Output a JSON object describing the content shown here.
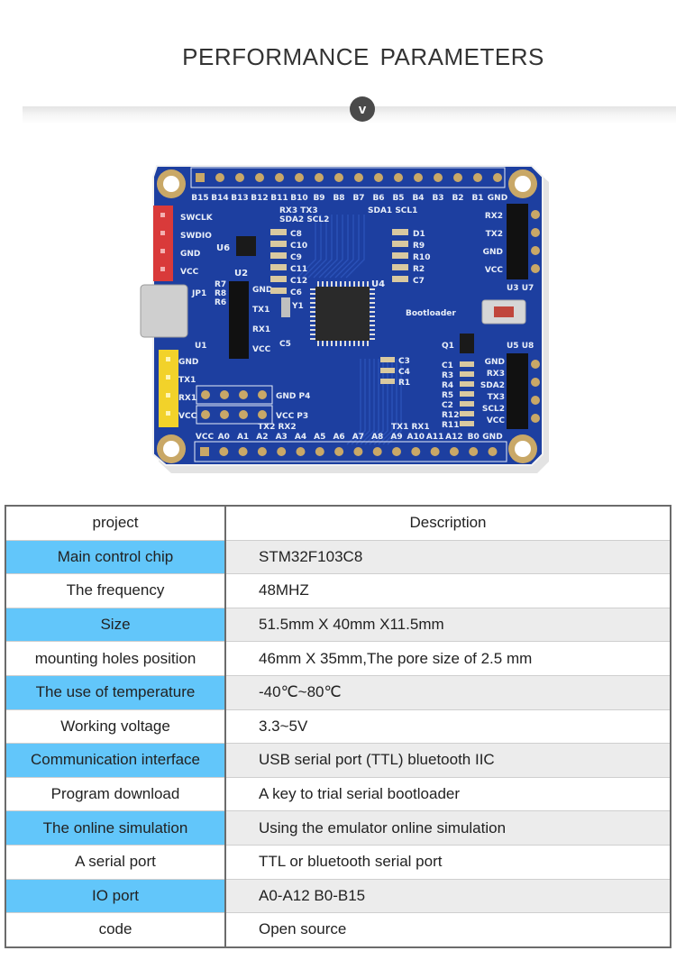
{
  "header": {
    "title": "PERFORMANCE  PARAMETERS",
    "badge_label": "v"
  },
  "board": {
    "top_pins": [
      "B15",
      "B14",
      "B13",
      "B12",
      "B11",
      "B10",
      "B9",
      "B8",
      "B7",
      "B6",
      "B5",
      "B4",
      "B3",
      "B2",
      "B1",
      "GND"
    ],
    "top_alt_labels": [
      "RX3 TX3",
      "SDA2 SCL2",
      "SDA1 SCL1"
    ],
    "bottom_pins": [
      "VCC",
      "A0",
      "A1",
      "A2",
      "A3",
      "A4",
      "A5",
      "A6",
      "A7",
      "A8",
      "A9",
      "A10",
      "A11",
      "A12",
      "B0",
      "GND"
    ],
    "bottom_alt_labels": [
      "TX2 RX2",
      "TX1 RX1"
    ],
    "swd_header": [
      "SWCLK",
      "SWDIO",
      "GND",
      "VCC"
    ],
    "uart1_header": [
      "GND",
      "TX1",
      "RX1",
      "VCC"
    ],
    "u2_header": [
      "GND",
      "TX1",
      "RX1",
      "VCC"
    ],
    "u3_header": [
      "RX2",
      "TX2",
      "GND",
      "VCC"
    ],
    "u5_header": [
      "GND",
      "RX3",
      "SDA2",
      "TX3",
      "SCL2",
      "VCC"
    ],
    "power_rows": [
      "GND P4",
      "VCC P3"
    ],
    "component_labels": {
      "caps_left": [
        "C8",
        "C10",
        "C9",
        "C11",
        "C12",
        "C6"
      ],
      "parts_right": [
        "D1",
        "R9",
        "R10",
        "R2",
        "C7"
      ],
      "parts_mid": [
        "C3",
        "C4",
        "R1"
      ],
      "parts_q1": [
        "C1",
        "R3",
        "R4",
        "R5",
        "C2",
        "R12",
        "R11"
      ],
      "refs": [
        "U1",
        "U2",
        "U3",
        "U4",
        "U5",
        "U6",
        "U7",
        "U8",
        "JP1",
        "R7",
        "R8",
        "R6",
        "Y1",
        "C5",
        "Q1"
      ]
    },
    "button_label": "Bootloader",
    "colors": {
      "pcb": "#1d3fa0",
      "silkscreen": "#e8eef8",
      "gold": "#c9a867",
      "red_header": "#d93a3a",
      "yellow_header": "#f2d22a"
    }
  },
  "table": {
    "headers": [
      "project",
      "Description"
    ],
    "rows": [
      {
        "project": "Main control chip",
        "description": "STM32F103C8",
        "highlight": true
      },
      {
        "project": "The frequency",
        "description": "48MHZ",
        "highlight": false
      },
      {
        "project": "Size",
        "description": "51.5mm X 40mm X11.5mm",
        "highlight": true
      },
      {
        "project": "mounting holes position",
        "description": "46mm X 35mm,The pore size of 2.5 mm",
        "highlight": false
      },
      {
        "project": "The use of temperature",
        "description": "-40℃~80℃",
        "highlight": true
      },
      {
        "project": "Working voltage",
        "description": "3.3~5V",
        "highlight": false
      },
      {
        "project": "Communication interface",
        "description": "USB serial port (TTL) bluetooth IIC",
        "highlight": true
      },
      {
        "project": "Program download",
        "description": "A key to trial serial bootloader",
        "highlight": false
      },
      {
        "project": "The online simulation",
        "description": "Using the emulator online simulation",
        "highlight": true
      },
      {
        "project": "A serial port",
        "description": "TTL or bluetooth serial port",
        "highlight": false
      },
      {
        "project": "IO port",
        "description": "A0-A12  B0-B15",
        "highlight": true
      },
      {
        "project": "code",
        "description": "Open source",
        "highlight": false
      }
    ],
    "colors": {
      "highlight_left": "#62c6fa",
      "highlight_right": "#ececec",
      "border": "#6b6b6b"
    }
  }
}
